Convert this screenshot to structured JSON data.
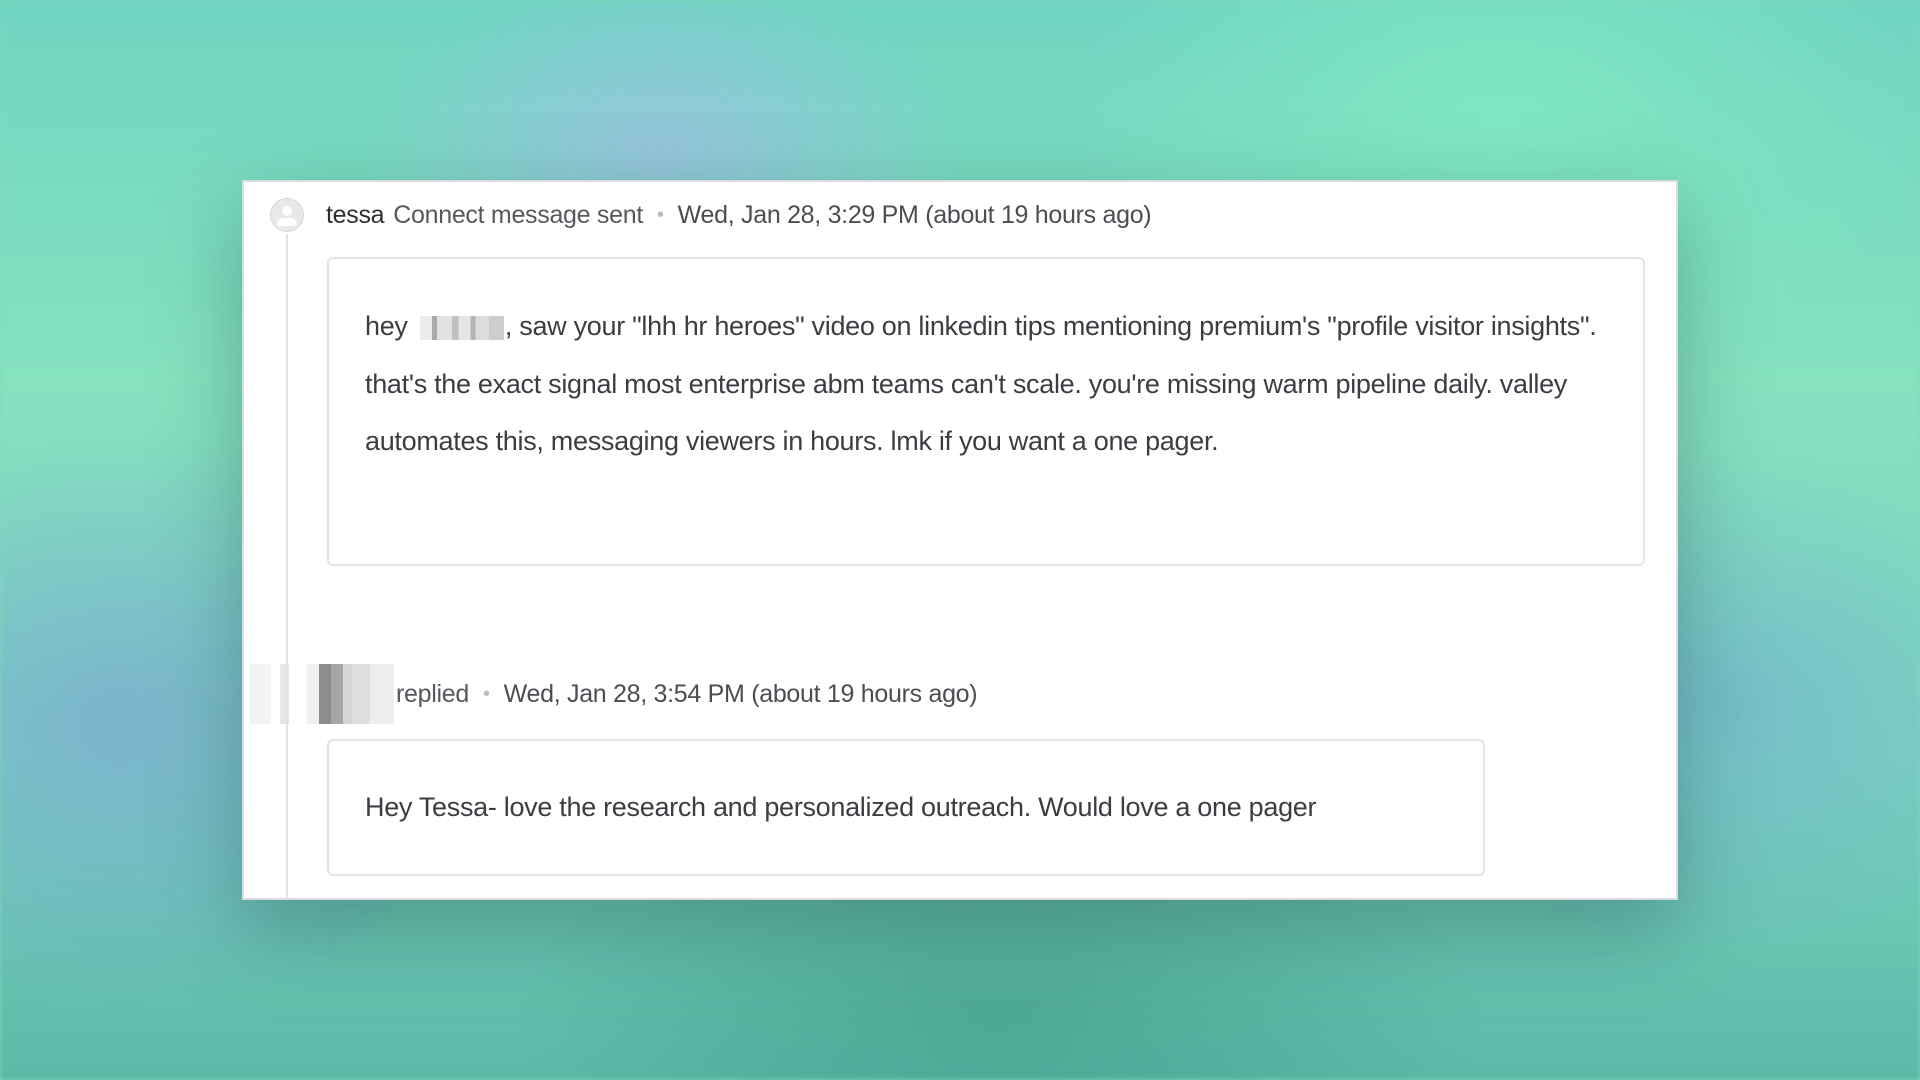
{
  "thread": {
    "messages": [
      {
        "sender": "tessa",
        "action": "Connect message sent",
        "separator": "•",
        "timestamp": "Wed, Jan 28, 3:29 PM (about 19 hours ago)",
        "body_before_name": "hey ",
        "body_after_name": ", saw your \"lhh hr heroes\" video on linkedin tips mentioning premium's \"profile visitor insights\". that's the exact signal most enterprise abm teams can't scale. you're missing warm pipeline daily. valley automates this, messaging viewers in hours. lmk if you want a one pager."
      },
      {
        "action": "replied",
        "separator": "•",
        "timestamp": "Wed, Jan 28, 3:54 PM (about 19 hours ago)",
        "body": "Hey Tessa- love the research and personalized outreach. Would love a one pager"
      }
    ]
  }
}
